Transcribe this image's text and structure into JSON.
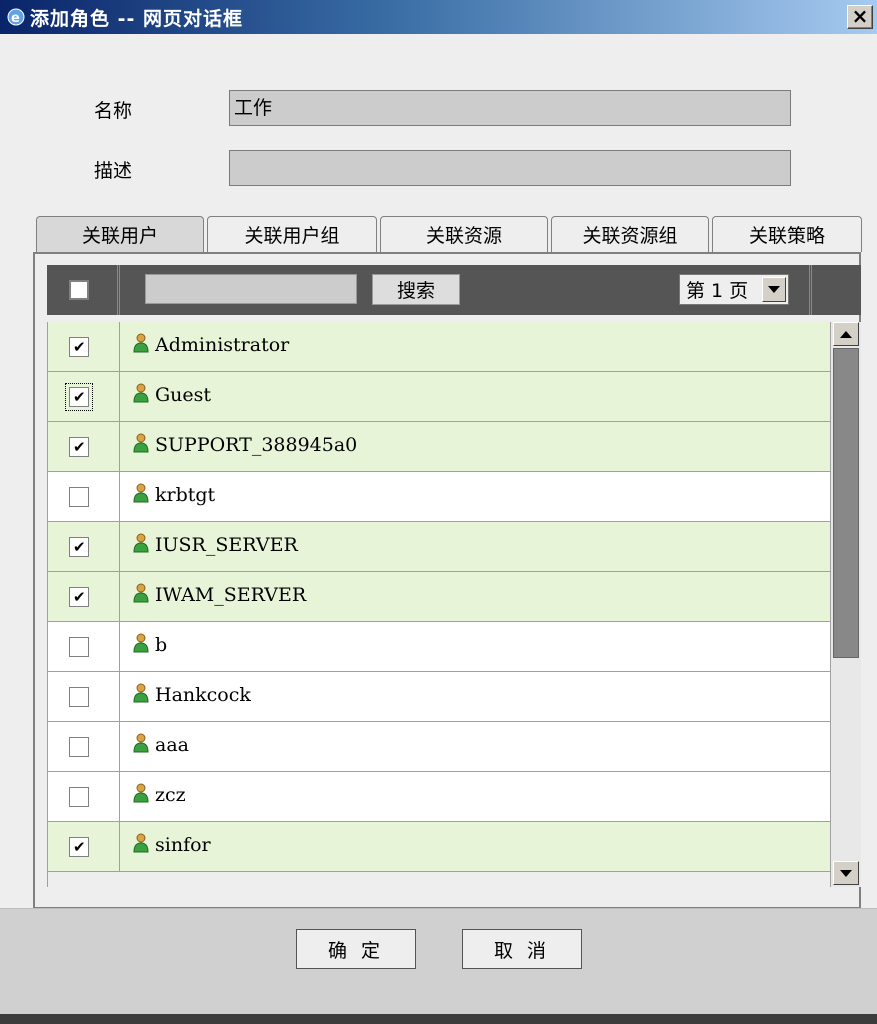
{
  "window": {
    "title": "添加角色 -- 网页对话框",
    "close_label": "×"
  },
  "form": {
    "name_label": "名称",
    "name_value": "工作",
    "desc_label": "描述",
    "desc_value": ""
  },
  "tabs": [
    {
      "label": "关联用户",
      "active": true
    },
    {
      "label": "关联用户组",
      "active": false
    },
    {
      "label": "关联资源",
      "active": false
    },
    {
      "label": "关联资源组",
      "active": false
    },
    {
      "label": "关联策略",
      "active": false
    }
  ],
  "toolbar": {
    "search_value": "",
    "search_button": "搜索",
    "page_select": "第 1 页"
  },
  "users": [
    {
      "name": "Administrator",
      "checked": true
    },
    {
      "name": "Guest",
      "checked": true
    },
    {
      "name": "SUPPORT_388945a0",
      "checked": true
    },
    {
      "name": "krbtgt",
      "checked": false
    },
    {
      "name": "IUSR_SERVER",
      "checked": true
    },
    {
      "name": "IWAM_SERVER",
      "checked": true
    },
    {
      "name": "b",
      "checked": false
    },
    {
      "name": "Hankcock",
      "checked": false
    },
    {
      "name": "aaa",
      "checked": false
    },
    {
      "name": "zcz",
      "checked": false
    },
    {
      "name": "sinfor",
      "checked": true
    }
  ],
  "footer": {
    "ok_label": "确 定",
    "cancel_label": "取 消"
  },
  "icons": {
    "title": "ie-icon",
    "user": "user-icon",
    "check": "✔"
  },
  "colors": {
    "titlebar_start": "#0a246a",
    "checked_row": "#e8f4d8",
    "toolbar": "#555555"
  }
}
